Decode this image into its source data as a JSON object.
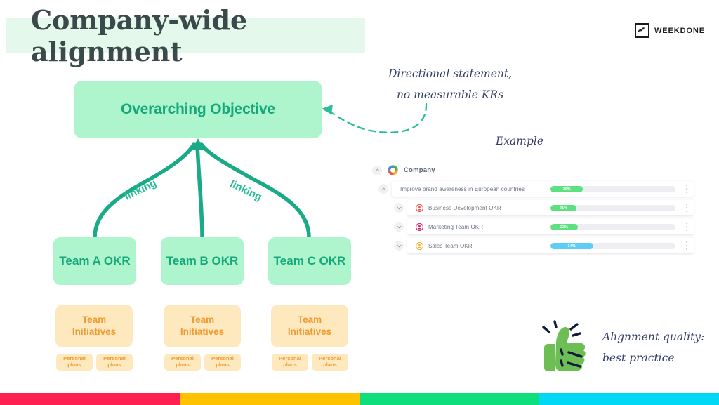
{
  "slide": {
    "title": "Company-wide alignment",
    "brand": {
      "name": "WEEKDONE",
      "mark_icon": "chart-zigzag-icon"
    }
  },
  "diagram": {
    "objective": {
      "label": "Overarching Objective",
      "color": "#aef5ce",
      "text_color": "#15a87a"
    },
    "link_labels": [
      "linking",
      "linking"
    ],
    "teams": [
      {
        "label": "Team A OKR"
      },
      {
        "label": "Team B OKR"
      },
      {
        "label": "Team C OKR"
      }
    ],
    "initiatives": [
      {
        "line1": "Team",
        "line2": "Initiatives"
      },
      {
        "line1": "Team",
        "line2": "Initiatives"
      },
      {
        "line1": "Team",
        "line2": "Initiatives"
      }
    ],
    "personal_plans": [
      {
        "line1": "Personal",
        "line2": "plans"
      },
      {
        "line1": "Personal",
        "line2": "plans"
      },
      {
        "line1": "Personal",
        "line2": "plans"
      },
      {
        "line1": "Personal",
        "line2": "plans"
      },
      {
        "line1": "Personal",
        "line2": "plans"
      },
      {
        "line1": "Personal",
        "line2": "plans"
      }
    ]
  },
  "annotations": {
    "directional_line1": "Directional statement,",
    "directional_line2": "no measurable KRs",
    "example": "Example",
    "quality_line1": "Alignment quality:",
    "quality_line2": "best practice"
  },
  "app_screenshot": {
    "company_label": "Company",
    "company_icon": "rainbow-ring-icon",
    "rows": [
      {
        "title": "Improve brand awareness in European countries",
        "percent": "26%",
        "fill_width": 26,
        "fill_color": "#5ee081",
        "avatar": null
      },
      {
        "title": "Business Development OKR",
        "percent": "21%",
        "fill_width": 21,
        "fill_color": "#5ee081",
        "avatar": "#e8554e"
      },
      {
        "title": "Marketing Team OKR",
        "percent": "22%",
        "fill_width": 22,
        "fill_color": "#5ee081",
        "avatar": "#d6246e"
      },
      {
        "title": "Sales Team OKR",
        "percent": "34%",
        "fill_width": 34,
        "fill_color": "#5ecdf5",
        "avatar": "#f0b429"
      }
    ]
  },
  "footer_colors": [
    "#ff2052",
    "#ffc200",
    "#0fde7d",
    "#00d8f5"
  ]
}
